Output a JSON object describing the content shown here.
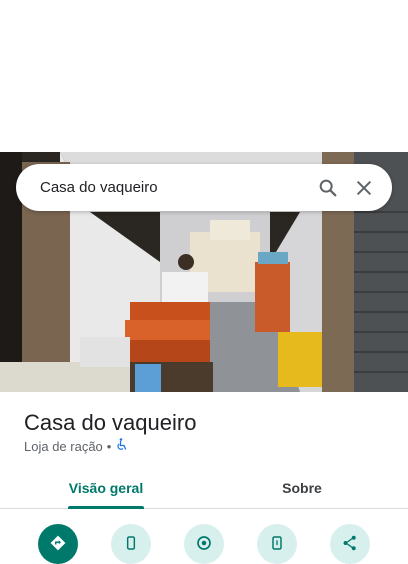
{
  "search": {
    "query": "Casa do vaqueiro"
  },
  "place": {
    "name": "Casa do vaqueiro",
    "category": "Loja de ração",
    "separator": "•",
    "accessibility_icon": "wheelchair-icon"
  },
  "tabs": [
    {
      "label": "Visão geral",
      "active": true
    },
    {
      "label": "Sobre",
      "active": false
    }
  ],
  "actions": [
    {
      "icon": "directions-icon",
      "style": "primary"
    },
    {
      "icon": "phone-icon",
      "style": "secondary"
    },
    {
      "icon": "nearby-icon",
      "style": "secondary"
    },
    {
      "icon": "send-to-phone-icon",
      "style": "secondary"
    },
    {
      "icon": "share-icon",
      "style": "secondary"
    }
  ],
  "colors": {
    "accent": "#00796b",
    "accent_light": "#d7efed",
    "accessibility_blue": "#1a73e8"
  }
}
